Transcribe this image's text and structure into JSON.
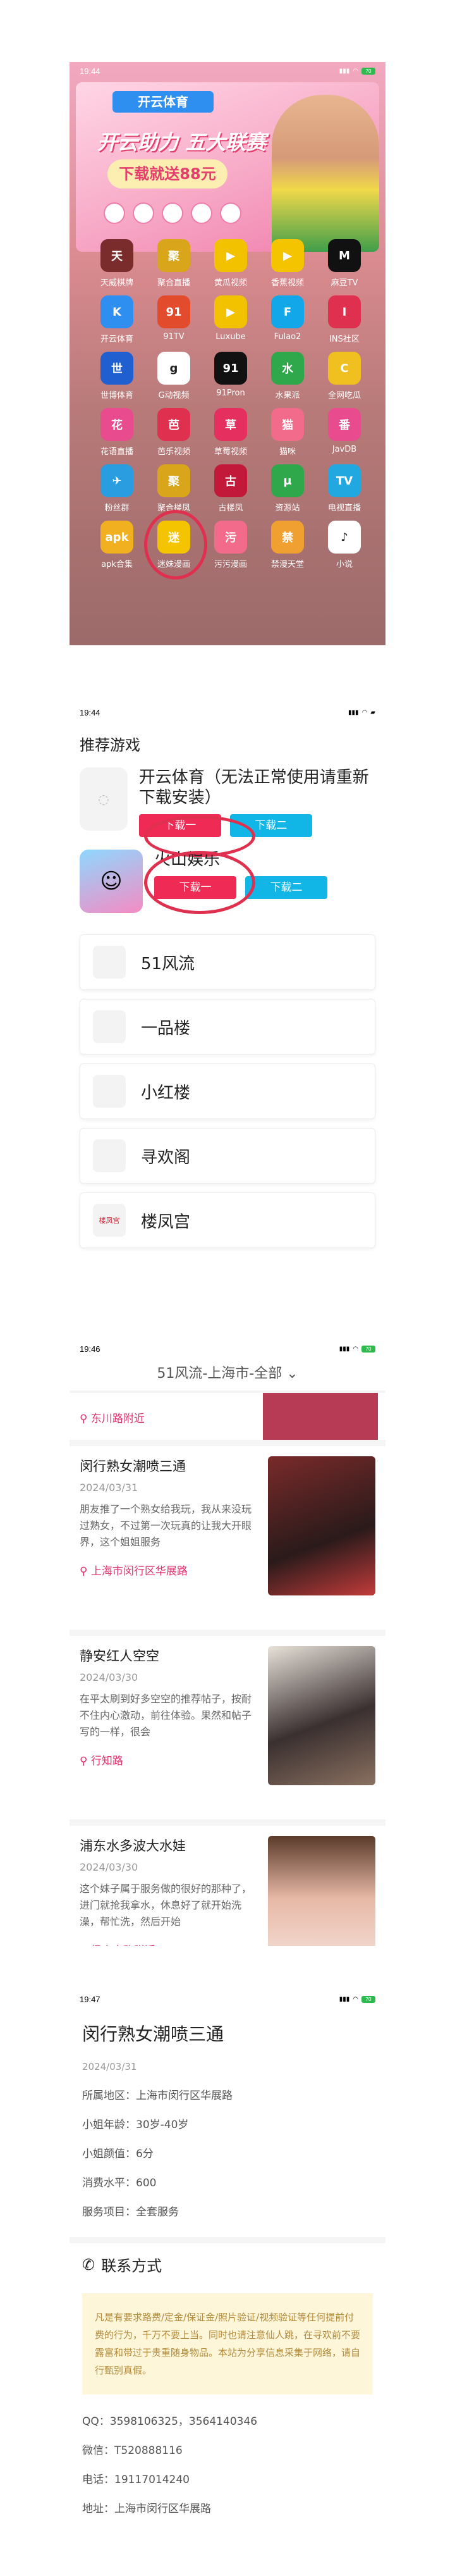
{
  "p1": {
    "time": "19:44",
    "battery": "70",
    "banner": {
      "logo": "开云体育",
      "headline": "开云助力 五大联赛",
      "subline": "下载就送88元"
    },
    "apps": [
      {
        "label": "天威棋牌",
        "color": "#7a2c2c",
        "glyph": "天"
      },
      {
        "label": "聚合直播",
        "color": "#d9a51a",
        "glyph": "聚"
      },
      {
        "label": "黄瓜视频",
        "color": "#f2c200",
        "glyph": "▶"
      },
      {
        "label": "香蕉视频",
        "color": "#f5c400",
        "glyph": "▶"
      },
      {
        "label": "麻豆TV",
        "color": "#111111",
        "glyph": "M"
      },
      {
        "label": "开云体育",
        "color": "#2f8ff0",
        "glyph": "K"
      },
      {
        "label": "91TV",
        "color": "#e34b2d",
        "glyph": "91"
      },
      {
        "label": "Luxube",
        "color": "#f2c200",
        "glyph": "▶"
      },
      {
        "label": "Fulao2",
        "color": "#12a7e8",
        "glyph": "F"
      },
      {
        "label": "INS社区",
        "color": "#e0304f",
        "glyph": "I"
      },
      {
        "label": "世博体育",
        "color": "#1f5fd0",
        "glyph": "世"
      },
      {
        "label": "G动视频",
        "color": "#ffffff",
        "glyph": "g"
      },
      {
        "label": "91Pron",
        "color": "#111111",
        "glyph": "91"
      },
      {
        "label": "水果派",
        "color": "#2ea84a",
        "glyph": "水"
      },
      {
        "label": "全网吃瓜",
        "color": "#f0c020",
        "glyph": "C"
      },
      {
        "label": "花语直播",
        "color": "#e94b8f",
        "glyph": "花"
      },
      {
        "label": "芭乐视频",
        "color": "#e0304f",
        "glyph": "芭"
      },
      {
        "label": "草莓视频",
        "color": "#e5305f",
        "glyph": "草"
      },
      {
        "label": "猫咪",
        "color": "#f26b8a",
        "glyph": "猫"
      },
      {
        "label": "JavDB",
        "color": "#e94b8f",
        "glyph": "番"
      },
      {
        "label": "粉丝群",
        "color": "#2a9de0",
        "glyph": "✈"
      },
      {
        "label": "聚合楼凤",
        "color": "#d9a51a",
        "glyph": "聚"
      },
      {
        "label": "古楼凤",
        "color": "#c2183a",
        "glyph": "古"
      },
      {
        "label": "资源站",
        "color": "#2ea84a",
        "glyph": "μ"
      },
      {
        "label": "电视直播",
        "color": "#22a8e0",
        "glyph": "TV"
      },
      {
        "label": "apk合集",
        "color": "#f0b020",
        "glyph": "apk"
      },
      {
        "label": "迷妹漫画",
        "color": "#f5c400",
        "glyph": "迷"
      },
      {
        "label": "污污漫画",
        "color": "#f26b8a",
        "glyph": "污"
      },
      {
        "label": "禁漫天堂",
        "color": "#f0a030",
        "glyph": "禁"
      },
      {
        "label": "小说",
        "color": "#ffffff",
        "glyph": "♪"
      }
    ]
  },
  "p2": {
    "time": "19:44",
    "title": "推荐游戏",
    "games": [
      {
        "name": "开云体育（无法正常使用请重新下载安装）",
        "btn1": "下载一",
        "btn2": "下载二"
      },
      {
        "name": "火山娱乐",
        "btn1": "下载一",
        "btn2": "下载二"
      }
    ],
    "rows": [
      "51风流",
      "一品楼",
      "小红楼",
      "寻欢阁",
      "楼凤宫"
    ],
    "row_icons": [
      "",
      "",
      "",
      "",
      "楼凤宫"
    ]
  },
  "p3": {
    "time": "19:46",
    "header": "51风流-上海市-全部",
    "prev_loc": "东川路附近",
    "cards": [
      {
        "title": "闵行熟女潮喷三通",
        "date": "2024/03/31",
        "desc": "朋友推了一个熟女给我玩，我从来没玩过熟女，不过第一次玩真的让我大开眼界，这个姐姐服务",
        "loc": "上海市闵行区华展路"
      },
      {
        "title": "静安红人空空",
        "date": "2024/03/30",
        "desc": "在平太刷到好多空空的推荐帖子，按耐不住内心激动，前往体验。果然和帖子写的一样，很会",
        "loc": "行知路"
      },
      {
        "title": "浦东水多波大水娃",
        "date": "2024/03/30",
        "desc": "这个妹子属于服务做的很好的那种了，进门就抢我拿水，休息好了就开始洗澡，帮忙洗，然后开始",
        "loc": "杨高南路附近"
      }
    ]
  },
  "p4": {
    "time": "19:47",
    "title": "闵行熟女潮喷三通",
    "date": "2024/03/31",
    "fields": [
      "所属地区：上海市闵行区华展路",
      "小姐年龄：30岁-40岁",
      "小姐颜值：6分",
      "消费水平：600",
      "服务项目：全套服务"
    ],
    "contact_title": "联系方式",
    "notice": "凡是有要求路费/定金/保证金/照片验证/视频验证等任何提前付费的行为，千万不要上当。同时也请注意仙人跳，在寻欢前不要露富和带过于贵重随身物品。本站为分享信息采集于网络，请自行甄别真假。",
    "contacts": [
      "QQ：3598106325，3564140346",
      "微信：T520888116",
      "电话：19117014240",
      "地址：上海市闵行区华展路"
    ]
  }
}
